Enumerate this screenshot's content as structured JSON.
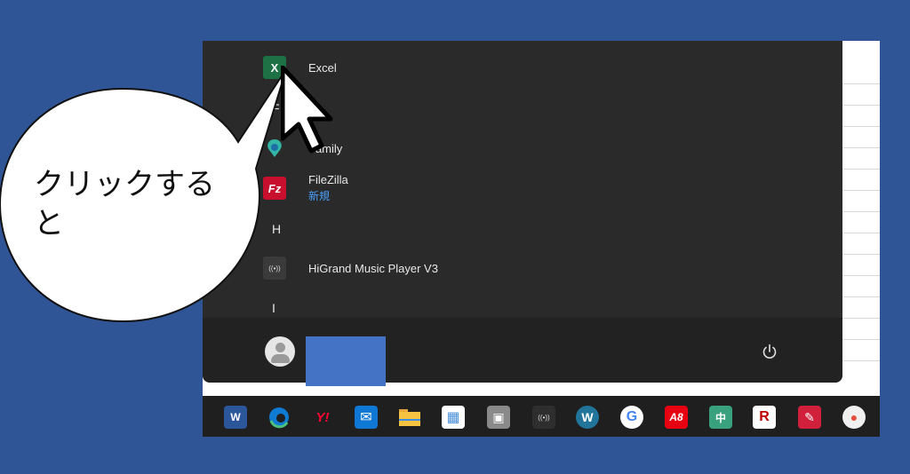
{
  "start_menu": {
    "apps": [
      {
        "name": "Excel",
        "subtitle": "",
        "icon": "excel-icon",
        "glyph": "X",
        "color": "#1e7145"
      },
      {
        "name": "Family",
        "subtitle": "",
        "icon": "family-icon",
        "glyph": "",
        "color": "#33b5a5"
      },
      {
        "name": "FileZilla",
        "subtitle": "新規",
        "icon": "filezilla-icon",
        "glyph": "Fz",
        "color": "#c8102e"
      },
      {
        "name": "HiGrand Music Player V3",
        "subtitle": "",
        "icon": "music-player-icon",
        "glyph": "((•))",
        "color": "#3a3a3a"
      }
    ],
    "letters": [
      "F",
      "H",
      "I"
    ]
  },
  "callout": {
    "text_line1": "クリックする",
    "text_line2": "と"
  },
  "taskbar": {
    "icons": [
      {
        "name": "word-icon",
        "glyph": "W",
        "color": "#2b579a"
      },
      {
        "name": "edge-icon",
        "glyph": "e",
        "color": "#0f7bd3"
      },
      {
        "name": "yahoo-icon",
        "glyph": "Y!",
        "color": "#ff0033"
      },
      {
        "name": "mail-icon",
        "glyph": "✉",
        "color": "#0f78d4"
      },
      {
        "name": "file-explorer-icon",
        "glyph": "",
        "color": "#f5c242"
      },
      {
        "name": "store-icon",
        "glyph": "▦",
        "color": "#4a90d9"
      },
      {
        "name": "app-icon",
        "glyph": "▣",
        "color": "#8a8a8a"
      },
      {
        "name": "music-player-icon",
        "glyph": "((•))",
        "color": "#2e2e2e"
      },
      {
        "name": "wordpress-icon",
        "glyph": "W",
        "color": "#21759b"
      },
      {
        "name": "google-icon",
        "glyph": "G",
        "color": "#ffffff"
      },
      {
        "name": "a8-icon",
        "glyph": "A8",
        "color": "#e60012"
      },
      {
        "name": "mahjong-icon",
        "glyph": "中",
        "color": "#3aa17e"
      },
      {
        "name": "rakuten-icon",
        "glyph": "R",
        "color": "#ffffff"
      },
      {
        "name": "notepad-icon",
        "glyph": "✎",
        "color": "#d0203b"
      },
      {
        "name": "paint-icon",
        "glyph": "●",
        "color": "#f0f0f0"
      }
    ]
  },
  "colors": {
    "background": "#2f5597",
    "start_menu": "#2a2a2a",
    "accent_link": "#4aa0ff",
    "user_block": "#4472c4"
  }
}
